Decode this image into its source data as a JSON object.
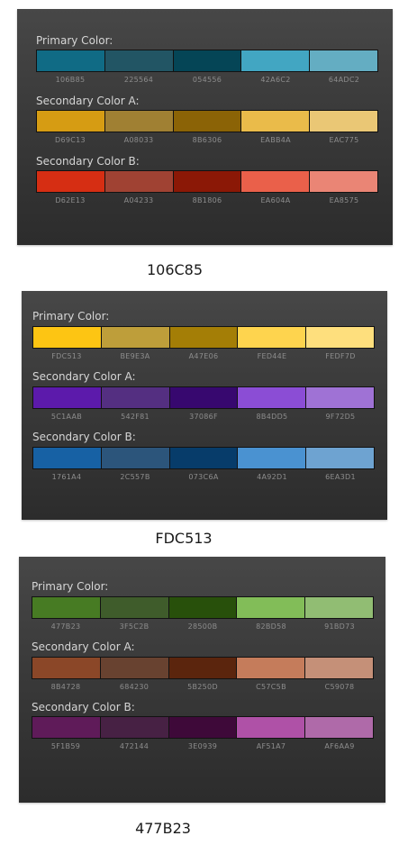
{
  "palettes": [
    {
      "caption": "106C85",
      "groups": [
        {
          "title": "Primary Color:",
          "swatches": [
            {
              "hex": "106B85",
              "color": "#106B85"
            },
            {
              "hex": "225564",
              "color": "#225564"
            },
            {
              "hex": "054556",
              "color": "#054556"
            },
            {
              "hex": "42A6C2",
              "color": "#42A6C2"
            },
            {
              "hex": "64ADC2",
              "color": "#64ADC2"
            }
          ]
        },
        {
          "title": "Secondary Color A:",
          "swatches": [
            {
              "hex": "D69C13",
              "color": "#D69C13"
            },
            {
              "hex": "A08033",
              "color": "#A08033"
            },
            {
              "hex": "8B6306",
              "color": "#8B6306"
            },
            {
              "hex": "EABB4A",
              "color": "#EABB4A"
            },
            {
              "hex": "EAC775",
              "color": "#EAC775"
            }
          ]
        },
        {
          "title": "Secondary Color B:",
          "swatches": [
            {
              "hex": "D62E13",
              "color": "#D62E13"
            },
            {
              "hex": "A04233",
              "color": "#A04233"
            },
            {
              "hex": "8B1806",
              "color": "#8B1806"
            },
            {
              "hex": "EA604A",
              "color": "#EA604A"
            },
            {
              "hex": "EA8575",
              "color": "#EA8575"
            }
          ]
        }
      ]
    },
    {
      "caption": "FDC513",
      "groups": [
        {
          "title": "Primary Color:",
          "swatches": [
            {
              "hex": "FDC513",
              "color": "#FDC513"
            },
            {
              "hex": "BE9E3A",
              "color": "#BE9E3A"
            },
            {
              "hex": "A47E06",
              "color": "#A47E06"
            },
            {
              "hex": "FED44E",
              "color": "#FED44E"
            },
            {
              "hex": "FEDF7D",
              "color": "#FEDF7D"
            }
          ]
        },
        {
          "title": "Secondary Color A:",
          "swatches": [
            {
              "hex": "5C1AAB",
              "color": "#5C1AAB"
            },
            {
              "hex": "542F81",
              "color": "#542F81"
            },
            {
              "hex": "37086F",
              "color": "#37086F"
            },
            {
              "hex": "8B4DD5",
              "color": "#8B4DD5"
            },
            {
              "hex": "9F72D5",
              "color": "#9F72D5"
            }
          ]
        },
        {
          "title": "Secondary Color B:",
          "swatches": [
            {
              "hex": "1761A4",
              "color": "#1761A4"
            },
            {
              "hex": "2C557B",
              "color": "#2C557B"
            },
            {
              "hex": "073C6A",
              "color": "#073C6A"
            },
            {
              "hex": "4A92D1",
              "color": "#4A92D1"
            },
            {
              "hex": "6EA3D1",
              "color": "#6EA3D1"
            }
          ]
        }
      ]
    },
    {
      "caption": "477B23",
      "groups": [
        {
          "title": "Primary Color:",
          "swatches": [
            {
              "hex": "477B23",
              "color": "#477B23"
            },
            {
              "hex": "3F5C2B",
              "color": "#3F5C2B"
            },
            {
              "hex": "28500B",
              "color": "#28500B"
            },
            {
              "hex": "82BD58",
              "color": "#82BD58"
            },
            {
              "hex": "91BD73",
              "color": "#91BD73"
            }
          ]
        },
        {
          "title": "Secondary Color A:",
          "swatches": [
            {
              "hex": "8B4728",
              "color": "#8B4728"
            },
            {
              "hex": "684230",
              "color": "#684230"
            },
            {
              "hex": "5B250D",
              "color": "#5B250D"
            },
            {
              "hex": "C57C5B",
              "color": "#C57C5B"
            },
            {
              "hex": "C59078",
              "color": "#C59078"
            }
          ]
        },
        {
          "title": "Secondary Color B:",
          "swatches": [
            {
              "hex": "5F1B59",
              "color": "#5F1B59"
            },
            {
              "hex": "472144",
              "color": "#472144"
            },
            {
              "hex": "3E0939",
              "color": "#3E0939"
            },
            {
              "hex": "AF51A7",
              "color": "#AF51A7"
            },
            {
              "hex": "AF6AA9",
              "color": "#AF6AA9"
            }
          ]
        }
      ]
    }
  ]
}
